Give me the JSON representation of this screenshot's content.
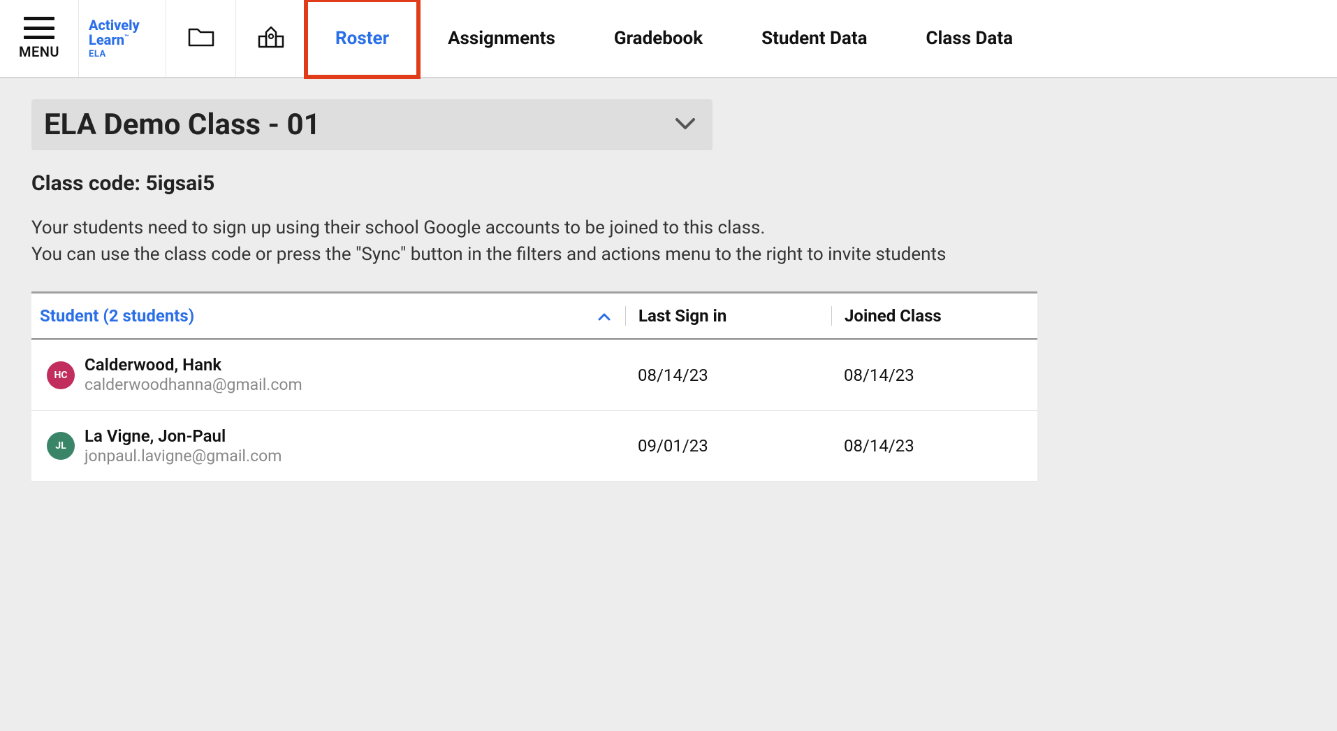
{
  "header": {
    "menu_label": "MENU",
    "logo_line1": "Actively",
    "logo_line2": "Learn",
    "logo_sub": "ELA",
    "tabs": {
      "roster": "Roster",
      "assignments": "Assignments",
      "gradebook": "Gradebook",
      "student_data": "Student Data",
      "class_data": "Class Data"
    }
  },
  "class_selector": {
    "title": "ELA Demo Class - 01"
  },
  "class_code_label": "Class code: 5igsai5",
  "info_line1": "Your students need to sign up using their school Google accounts to be joined to this class.",
  "info_line2": "You can use the class code or press the \"Sync\" button in the filters and actions menu to the right to invite students",
  "table": {
    "headers": {
      "student": "Student (2 students)",
      "last_sign_in": "Last Sign in",
      "joined_class": "Joined Class"
    },
    "rows": [
      {
        "initials": "HC",
        "avatar_color": "#c12e5e",
        "name": "Calderwood, Hank",
        "email": "calderwoodhanna@gmail.com",
        "last_sign_in": "08/14/23",
        "joined": "08/14/23"
      },
      {
        "initials": "JL",
        "avatar_color": "#3a8568",
        "name": "La Vigne, Jon-Paul",
        "email": "jonpaul.lavigne@gmail.com",
        "last_sign_in": "09/01/23",
        "joined": "08/14/23"
      }
    ]
  }
}
